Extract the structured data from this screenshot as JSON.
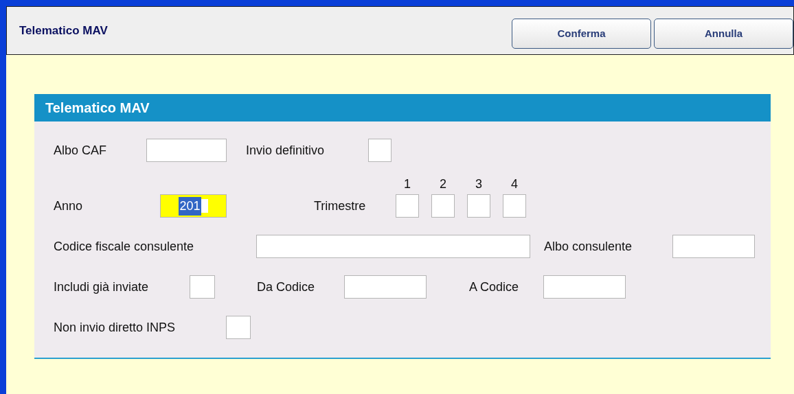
{
  "header": {
    "title": "Telematico MAV",
    "buttons": [
      "Conferma",
      "Annulla"
    ]
  },
  "panel": {
    "title": "Telematico MAV",
    "rows": [
      [
        {
          "kind": "text",
          "label": "Albo CAF"
        },
        {
          "kind": "check",
          "label": "Invio definitivo",
          "checked": false
        }
      ],
      [
        {
          "kind": "text",
          "label": "Anno",
          "value": "201",
          "focused": true
        },
        {
          "kind": "quarters",
          "label": "Trimestre",
          "boxes": [
            {
              "number": "1",
              "checked": false
            },
            {
              "number": "2",
              "checked": false
            },
            {
              "number": "3",
              "checked": false
            },
            {
              "number": "4",
              "checked": false
            }
          ]
        }
      ],
      [
        {
          "kind": "text",
          "label": "Codice fiscale consulente"
        },
        {
          "kind": "text",
          "label": "Albo consulente"
        }
      ],
      [
        {
          "kind": "check",
          "label": "Includi già inviate",
          "checked": false
        },
        {
          "kind": "text",
          "label": "Da Codice"
        },
        {
          "kind": "text",
          "label": "A Codice"
        }
      ],
      [
        {
          "kind": "check",
          "label": "Non invio diretto INPS",
          "checked": false
        }
      ]
    ]
  }
}
